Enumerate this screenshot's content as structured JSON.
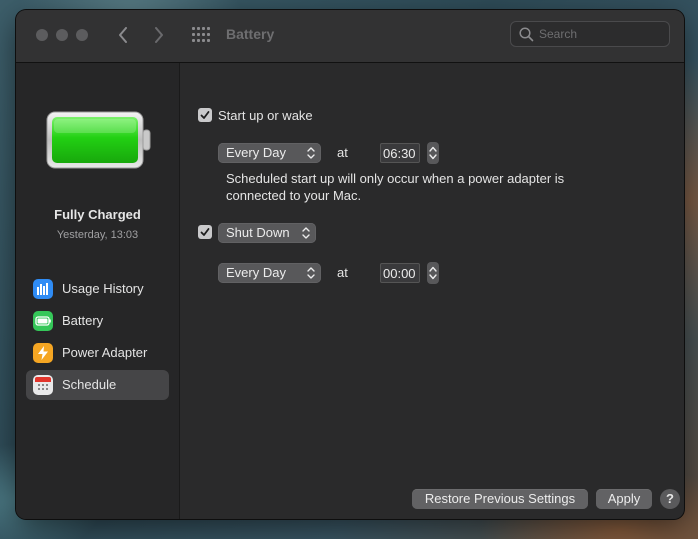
{
  "window": {
    "title": "Battery"
  },
  "search": {
    "placeholder": "Search"
  },
  "status": {
    "title": "Fully Charged",
    "time": "Yesterday, 13:03"
  },
  "sidebar": {
    "items": [
      {
        "label": "Usage History",
        "icon": "bar-chart-icon",
        "color": "#2f8cf5"
      },
      {
        "label": "Battery",
        "icon": "battery-icon",
        "color": "#35c759"
      },
      {
        "label": "Power Adapter",
        "icon": "lightning-icon",
        "color": "#f5a623"
      },
      {
        "label": "Schedule",
        "icon": "calendar-icon",
        "color": "#e9e9ea"
      }
    ],
    "selected": "Schedule"
  },
  "schedule": {
    "startup": {
      "label": "Start up or wake",
      "checked": true,
      "frequency": "Every Day",
      "at_label": "at",
      "time": "06:30",
      "note": "Scheduled start up will only occur when a power adapter is connected to your Mac."
    },
    "shutdown": {
      "checked": true,
      "action": "Shut Down",
      "frequency": "Every Day",
      "at_label": "at",
      "time": "00:00"
    }
  },
  "footer": {
    "restore_label": "Restore Previous Settings",
    "apply_label": "Apply",
    "help_label": "?"
  },
  "colors": {
    "battery_fill": "#2ed21f",
    "accent": "#2f8cf5"
  }
}
